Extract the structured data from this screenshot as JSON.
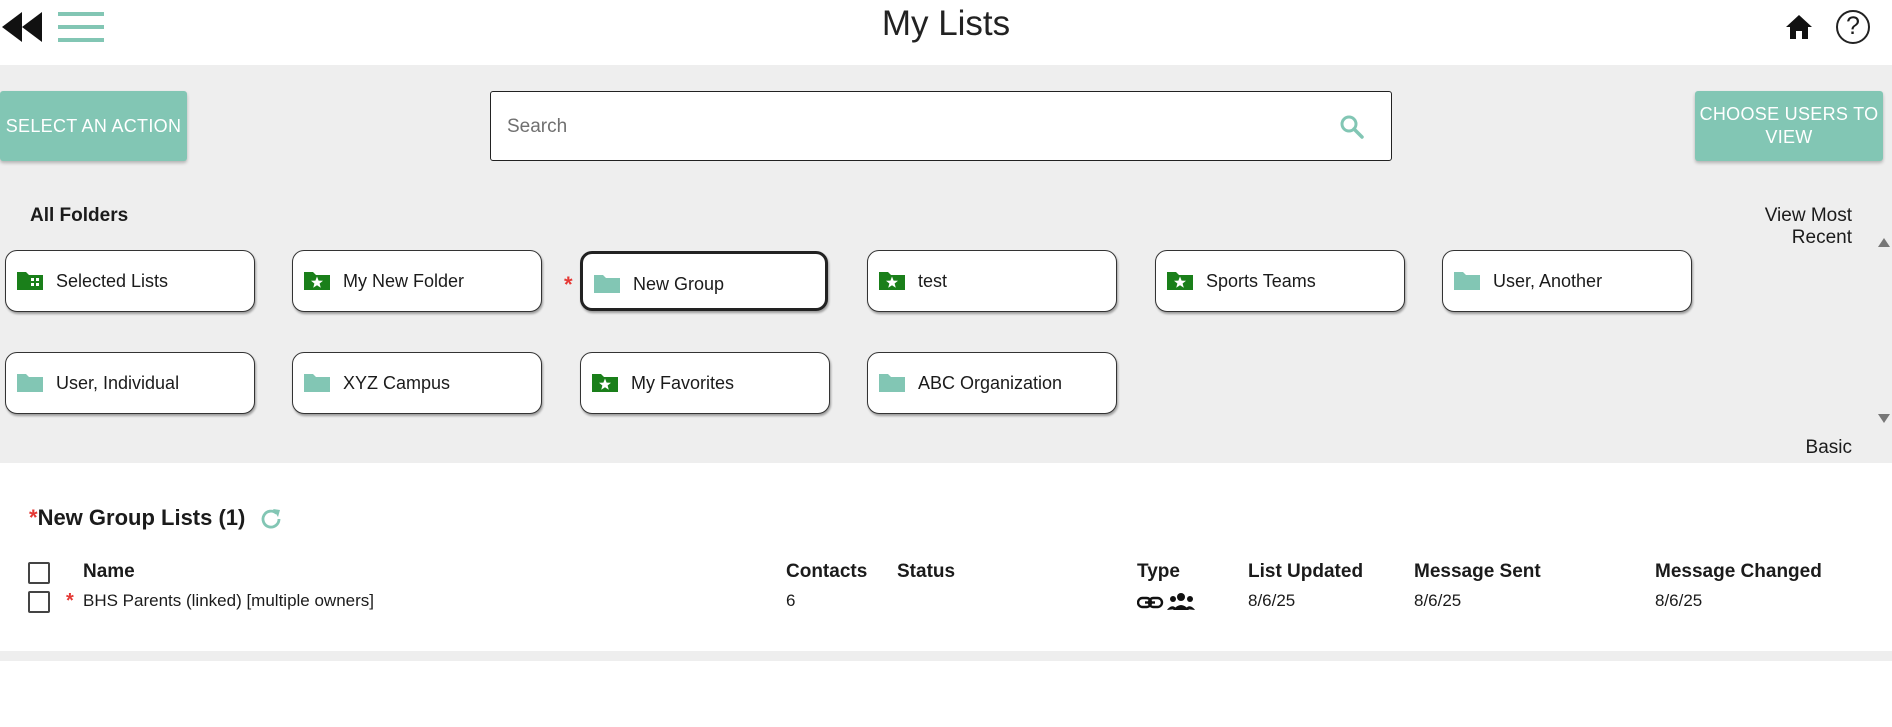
{
  "header": {
    "title": "My Lists"
  },
  "toolbar": {
    "action_label": "Select an Action",
    "choose_users_label": "Choose Users to View",
    "search_placeholder": "Search"
  },
  "folders": {
    "heading": "All Folders",
    "view_most_recent": "View Most Recent",
    "basic_label": "Basic",
    "items": [
      {
        "label": "Selected Lists",
        "icon": "selected-lists-folder-icon"
      },
      {
        "label": "My New Folder",
        "icon": "star-folder-icon"
      },
      {
        "label": "New Group",
        "icon": "folder-icon",
        "active": true
      },
      {
        "label": "test",
        "icon": "star-folder-icon"
      },
      {
        "label": "Sports Teams",
        "icon": "star-folder-icon"
      },
      {
        "label": "User, Another",
        "icon": "folder-icon"
      },
      {
        "label": "User, Individual",
        "icon": "folder-icon"
      },
      {
        "label": "XYZ Campus",
        "icon": "folder-icon"
      },
      {
        "label": "My Favorites",
        "icon": "star-folder-icon"
      },
      {
        "label": "ABC Organization",
        "icon": "folder-icon"
      }
    ]
  },
  "lists": {
    "title": "New Group Lists (1)",
    "columns": [
      "Name",
      "Contacts",
      "Status",
      "Type",
      "List Updated",
      "Message Sent",
      "Message Changed"
    ],
    "rows": [
      {
        "name": "BHS Parents (linked) [multiple owners]",
        "contacts": "6",
        "status": "",
        "type_icons": [
          "link-icon",
          "group-icon"
        ],
        "list_updated": "8/6/25",
        "message_sent": "8/6/25",
        "message_changed": "8/6/25"
      }
    ]
  },
  "colors": {
    "accent": "#82c6b4",
    "folder_green": "#1a7f1a",
    "required_star": "#e53935",
    "panel_gray": "#eeeeee"
  }
}
